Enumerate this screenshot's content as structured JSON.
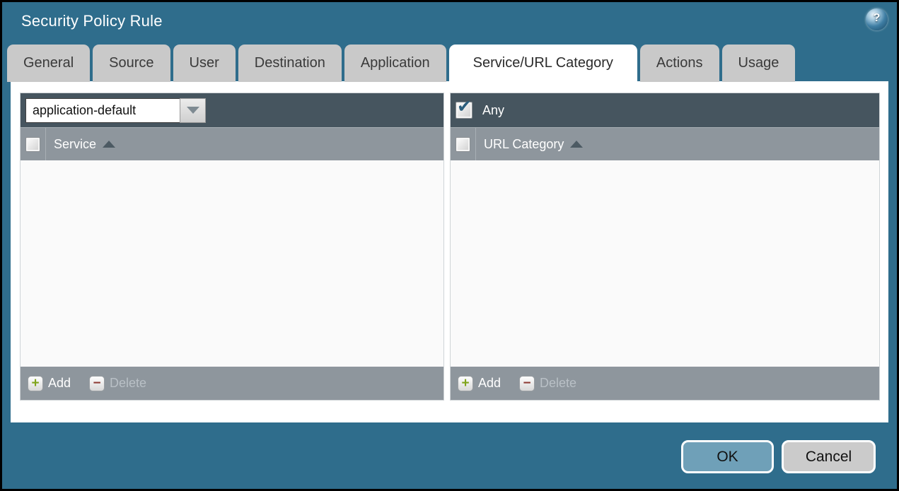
{
  "window": {
    "title": "Security Policy Rule"
  },
  "icons": {
    "help": "?",
    "check": "✔",
    "add_plus": "+",
    "delete_minus": "−"
  },
  "tabs": [
    {
      "label": "General"
    },
    {
      "label": "Source"
    },
    {
      "label": "User"
    },
    {
      "label": "Destination"
    },
    {
      "label": "Application"
    },
    {
      "label": "Service/URL Category"
    },
    {
      "label": "Actions"
    },
    {
      "label": "Usage"
    }
  ],
  "active_tab": "Service/URL Category",
  "service_panel": {
    "dropdown_value": "application-default",
    "column_header": "Service",
    "rows": [],
    "add_label": "Add",
    "delete_label": "Delete",
    "delete_enabled": false
  },
  "url_category_panel": {
    "any_label": "Any",
    "any_checked": true,
    "column_header": "URL Category",
    "rows": [],
    "add_label": "Add",
    "delete_label": "Delete",
    "delete_enabled": false
  },
  "actions": {
    "ok_label": "OK",
    "cancel_label": "Cancel"
  },
  "colors": {
    "background_teal": "#2F6D8C",
    "panel_toolbar": "#46555F",
    "panel_header_gray": "#8E969D",
    "ok_button_blue": "#6FA0B8",
    "add_plus_green": "#7FA41B",
    "delete_minus_red": "#8E3B35"
  }
}
